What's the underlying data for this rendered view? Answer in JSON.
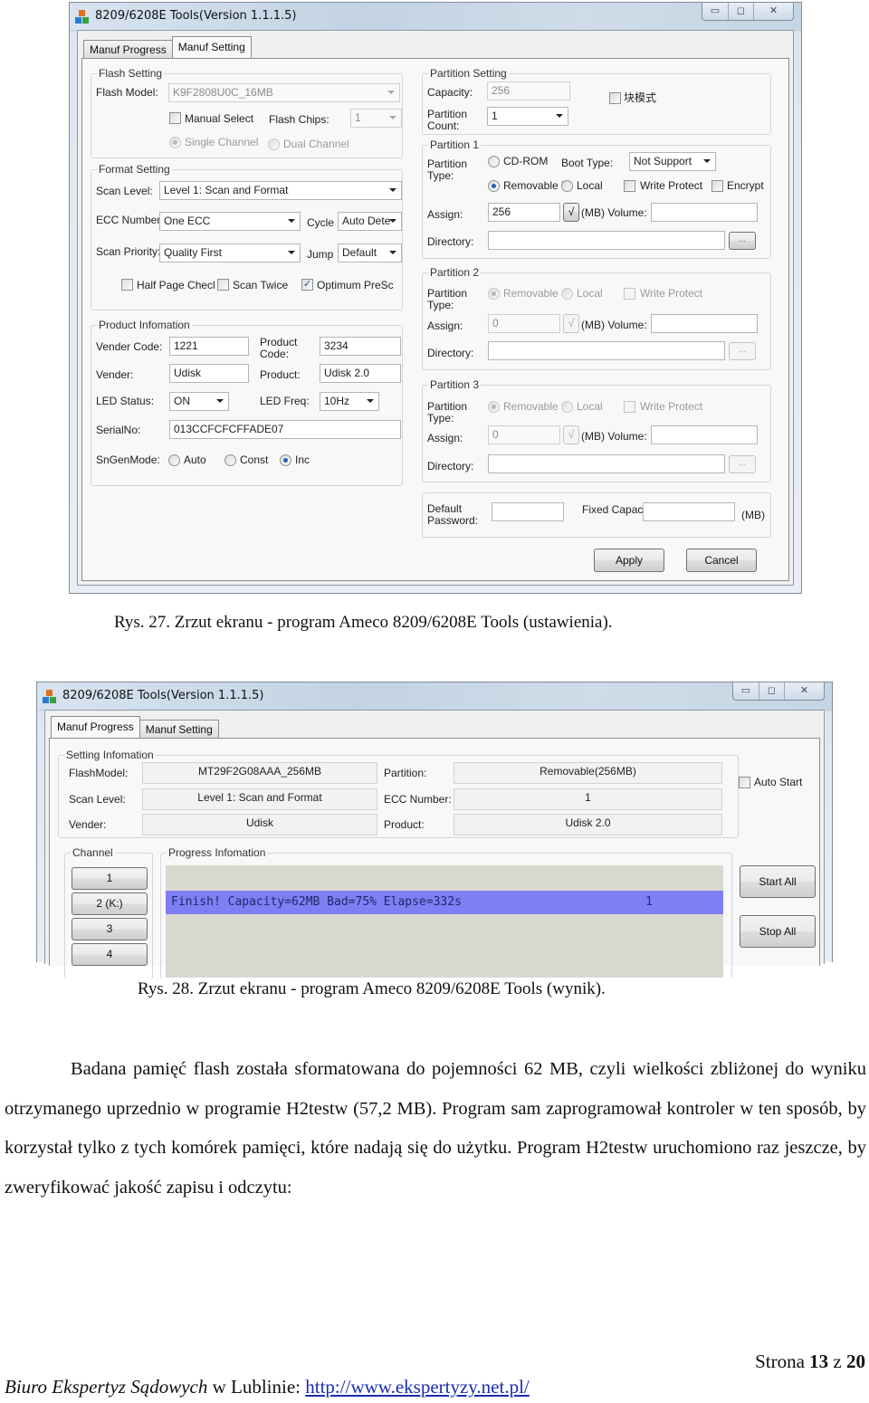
{
  "figure1": {
    "window_title": "8209/6208E Tools(Version 1.1.1.5)",
    "window_buttons": {
      "minimize": "▭",
      "maximize": "◻",
      "close": "✕"
    },
    "tabs": [
      {
        "label": "Manuf Progress",
        "active": false
      },
      {
        "label": "Manuf Setting",
        "active": true
      }
    ],
    "flash_setting": {
      "legend": "Flash Setting",
      "flash_model_label": "Flash Model:",
      "flash_model_value": "K9F2808U0C_16MB",
      "manual_select_label": "Manual Select",
      "manual_select_checked": false,
      "flash_chips_label": "Flash Chips:",
      "flash_chips_value": "1",
      "single_channel_label": "Single Channel",
      "dual_channel_label": "Dual Channel",
      "channel_mode": "Single Channel"
    },
    "format_setting": {
      "legend": "Format Setting",
      "scan_level_label": "Scan Level:",
      "scan_level_value": "Level 1: Scan and Format",
      "ecc_label": "ECC Number:",
      "ecc_value": "One ECC",
      "cycle_label": "Cycle",
      "cycle_value": "Auto Dete",
      "scan_priority_label": "Scan Priority:",
      "scan_priority_value": "Quality First",
      "jump_label": "Jump",
      "jump_value": "Default",
      "half_page_label": "Half Page Checl",
      "half_page_checked": false,
      "scan_twice_label": "Scan Twice",
      "scan_twice_checked": false,
      "optimum_label": "Optimum PreSc",
      "optimum_checked": true
    },
    "product_info": {
      "legend": "Product Infomation",
      "vender_code_label": "Vender Code:",
      "vender_code_value": "1221",
      "product_code_label": "Product Code:",
      "product_code_value": "3234",
      "vender_label": "Vender:",
      "vender_value": "Udisk",
      "product_label": "Product:",
      "product_value": "Udisk 2.0",
      "led_status_label": "LED Status:",
      "led_status_value": "ON",
      "led_freq_label": "LED Freq:",
      "led_freq_value": "10Hz",
      "serial_label": "SerialNo:",
      "serial_value": "013CCFCFCFFADE07",
      "sngen_label": "SnGenMode:",
      "sngen_options": [
        "Auto",
        "Const",
        "Inc"
      ],
      "sngen_selected": "Inc"
    },
    "partition_setting": {
      "legend": "Partition Setting",
      "capacity_label": "Capacity:",
      "capacity_value": "256",
      "count_label": "Partition Count:",
      "count_value": "1",
      "block_mode_label": "块模式",
      "block_mode_checked": false
    },
    "partition1": {
      "legend": "Partition 1",
      "type_label": "Partition Type:",
      "cdrom_label": "CD-ROM",
      "boot_type_label": "Boot Type:",
      "boot_type_value": "Not Support",
      "removable_label": "Removable I",
      "local_label": "Local",
      "selected_type": "Removable",
      "write_protect_label": "Write Protect",
      "encrypt_label": "Encrypt",
      "assign_label": "Assign:",
      "assign_value": "256",
      "check_btn": "√",
      "mb_volume_label": "(MB) Volume:",
      "volume_value": "",
      "directory_label": "Directory:",
      "directory_value": "",
      "browse_btn": "..."
    },
    "partition2": {
      "legend": "Partition 2",
      "type_label": "Partition Type:",
      "removable_label": "Removable",
      "local_label": "Local",
      "write_protect_label": "Write Protect",
      "assign_label": "Assign:",
      "assign_value": "0",
      "check_btn": "√",
      "mb_volume_label": "(MB) Volume:",
      "directory_label": "Directory:",
      "browse_btn": "..."
    },
    "partition3": {
      "legend": "Partition 3",
      "type_label": "Partition Type:",
      "removable_label": "Removable",
      "local_label": "Local",
      "write_protect_label": "Write Protect",
      "assign_label": "Assign:",
      "assign_value": "0",
      "check_btn": "√",
      "mb_volume_label": "(MB) Volume:",
      "directory_label": "Directory:",
      "browse_btn": "..."
    },
    "misc": {
      "default_password_label": "Default Password:",
      "default_password_value": "",
      "fixed_capacity_label": "Fixed Capacit",
      "fixed_capacity_value": "",
      "mb_label": "(MB)"
    },
    "apply_label": "Apply",
    "cancel_label": "Cancel",
    "caption": "Rys. 27. Zrzut ekranu - program Ameco 8209/6208E Tools (ustawienia)."
  },
  "figure2": {
    "window_title": "8209/6208E Tools(Version 1.1.1.5)",
    "tabs": [
      {
        "label": "Manuf Progress",
        "active": true
      },
      {
        "label": "Manuf Setting",
        "active": false
      }
    ],
    "setting_info": {
      "legend": "Setting Infomation",
      "flash_model_label": "FlashModel:",
      "flash_model_value": "MT29F2G08AAA_256MB",
      "scan_level_label": "Scan Level:",
      "scan_level_value": "Level 1: Scan and Format",
      "vender_label": "Vender:",
      "vender_value": "Udisk",
      "partition_label": "Partition:",
      "partition_value": "Removable(256MB)",
      "ecc_label": "ECC Number:",
      "ecc_value": "1",
      "product_label": "Product:",
      "product_value": "Udisk 2.0"
    },
    "auto_start_label": "Auto Start",
    "auto_start_checked": false,
    "channel_legend": "Channel",
    "channels": [
      "1",
      "2 (K:)",
      "3",
      "4"
    ],
    "progress_legend": "Progress Infomation",
    "progress_rows": [
      {
        "message": "",
        "count": "",
        "selected": false
      },
      {
        "message": "Finish! Capacity=62MB Bad=75% Elapse=332s",
        "count": "1",
        "selected": true
      },
      {
        "message": "",
        "count": "",
        "selected": false
      },
      {
        "message": "",
        "count": "",
        "selected": false
      }
    ],
    "start_all_label": "Start All",
    "stop_all_label": "Stop All",
    "caption": "Rys. 28. Zrzut ekranu - program Ameco 8209/6208E Tools (wynik)."
  },
  "paragraph": "Badana pamięć flash została sformatowana do pojemności 62 MB, czyli wielkości zbliżonej do wyniku otrzymanego uprzednio w programie H2testw (57,2 MB). Program sam zaprogramował kontroler w ten sposób, by korzystał tylko z tych komórek pamięci, które nadają się do użytku. Program H2testw uruchomiono raz jeszcze, by zweryfikować jakość zapisu i odczytu:",
  "footer": {
    "page_prefix": "Strona",
    "page_current": "13",
    "page_sep": "z",
    "page_total": "20",
    "office_italic": "Biuro Ekspertyz Sądowych",
    "office_rest": " w Lublinie: ",
    "link": "http://www.ekspertyzy.net.pl/"
  },
  "colors": {
    "selected_row": "#7f7ff4",
    "link": "#1a2cb0",
    "radio_on": "#2b62b8"
  }
}
